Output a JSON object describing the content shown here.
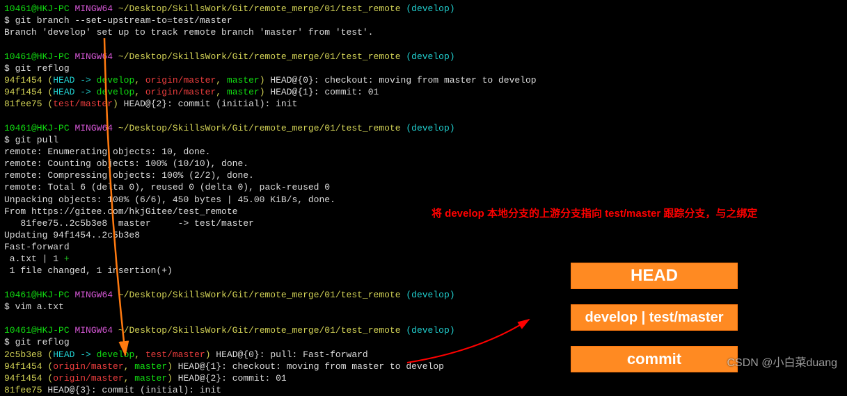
{
  "prompt": {
    "user": "10461@HKJ-PC",
    "shell": "MINGW64",
    "path": "~/Desktop/SkillsWork/Git/remote_merge/01/test_remote",
    "branch": "(develop)"
  },
  "blocks": [
    {
      "cmd": "git branch --set-upstream-to=test/master",
      "out": [
        {
          "text": "Branch 'develop' set up to track remote branch 'master' from 'test'."
        }
      ]
    },
    {
      "cmd": "git reflog",
      "out": [
        {
          "hash": "94f1454",
          "refs": [
            " (",
            "HEAD -> ",
            "develop",
            ", ",
            "origin/master",
            ", ",
            "master",
            ")"
          ],
          "rest": " HEAD@{0}: checkout: moving from master to develop"
        },
        {
          "hash": "94f1454",
          "refs": [
            " (",
            "HEAD -> ",
            "develop",
            ", ",
            "origin/master",
            ", ",
            "master",
            ")"
          ],
          "rest": " HEAD@{1}: commit: 01"
        },
        {
          "hash": "81fee75",
          "refs": [
            " (",
            "test/master",
            ")"
          ],
          "rest": " HEAD@{2}: commit (initial): init"
        }
      ]
    },
    {
      "cmd": "git pull",
      "out": [
        {
          "text": "remote: Enumerating objects: 10, done."
        },
        {
          "text": "remote: Counting objects: 100% (10/10), done."
        },
        {
          "text": "remote: Compressing objects: 100% (2/2), done."
        },
        {
          "text": "remote: Total 6 (delta 0), reused 0 (delta 0), pack-reused 0"
        },
        {
          "text": "Unpacking objects: 100% (6/6), 450 bytes | 45.00 KiB/s, done."
        },
        {
          "text": "From https://gitee.com/hkjGitee/test_remote"
        },
        {
          "text": "   81fee75..2c5b3e8  master     -> test/master"
        },
        {
          "text": "Updating 94f1454..2c5b3e8"
        },
        {
          "text": "Fast-forward"
        },
        {
          "text": " a.txt | 1 ",
          "plus": "+"
        },
        {
          "text": " 1 file changed, 1 insertion(+)"
        }
      ]
    },
    {
      "cmd": "vim a.txt",
      "out": []
    },
    {
      "cmd": "git reflog",
      "out": [
        {
          "hash": "2c5b3e8",
          "refs": [
            " (",
            "HEAD -> ",
            "develop",
            ", ",
            "test/master",
            ")"
          ],
          "rest": " HEAD@{0}: pull: Fast-forward"
        },
        {
          "hash": "94f1454",
          "refs": [
            " (",
            "origin/master",
            ", ",
            "master",
            ")"
          ],
          "rest": " HEAD@{1}: checkout: moving from master to develop"
        },
        {
          "hash": "94f1454",
          "refs": [
            " (",
            "origin/master",
            ", ",
            "master",
            ")"
          ],
          "rest": " HEAD@{2}: commit: 01"
        },
        {
          "hash": "81fee75",
          "refs": [],
          "rest": " HEAD@{3}: commit (initial): init"
        }
      ]
    }
  ],
  "annotation": "将 develop 本地分支的上游分支指向 test/master 跟踪分支，与之绑定",
  "boxes": [
    "HEAD",
    "develop | test/master",
    "commit"
  ],
  "watermark": "CSDN @小白菜duang"
}
